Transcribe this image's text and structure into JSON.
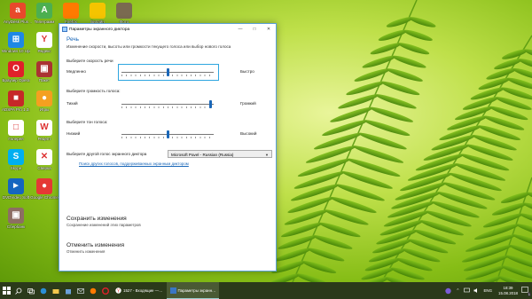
{
  "desktop_icons": [
    {
      "label": "AnyDesk Plus …",
      "color": "#e8492b",
      "glyph": "a"
    },
    {
      "label": "Телеграмм",
      "color": "#4caf50",
      "glyph": "A"
    },
    {
      "label": "Firefox",
      "color": "#ff7a00",
      "glyph": ""
    },
    {
      "label": "Билайн",
      "color": "#f5c400",
      "glyph": ""
    },
    {
      "label": "Фото",
      "color": "#7a6a50",
      "glyph": ""
    },
    {
      "label": "Windows 10 Update As…",
      "color": "#1e88e5",
      "glyph": "⊞"
    },
    {
      "label": "Яндекс",
      "color": "#ffffff",
      "glyph": "Y"
    },
    {
      "label": "Браузер Opera",
      "color": "#e0202a",
      "glyph": "O"
    },
    {
      "label": "Пакет",
      "color": "#a33",
      "glyph": "▣"
    },
    {
      "label": "ADSPA Pro 1.3.1.8",
      "color": "#c62828",
      "glyph": "■"
    },
    {
      "label": "Игры",
      "color": "#f4a020",
      "glyph": "●"
    },
    {
      "label": "Галерея",
      "color": "#ffffff",
      "glyph": "□"
    },
    {
      "label": "Рецепт",
      "color": "#ffffff",
      "glyph": "W"
    },
    {
      "label": "Skype",
      "color": "#00aff0",
      "glyph": "S"
    },
    {
      "label": "Сверка",
      "color": "#ffffff",
      "glyph": "✕"
    },
    {
      "label": "DVDVideo Soft",
      "color": "#1565c0",
      "glyph": "►"
    },
    {
      "label": "Google Chrome",
      "color": "#e53935",
      "glyph": "●"
    },
    {
      "label": "Сбербанк",
      "color": "#8d6e63",
      "glyph": "▣"
    }
  ],
  "window": {
    "title": "Параметры экранного диктора",
    "minimize": "—",
    "maximize": "□",
    "close": "✕",
    "header": "Речь",
    "subheader": "Изменение скорости, высоты или громкости текущего голоса или выбор нового голоса",
    "speed": {
      "label": "Выберите скорость речи",
      "low": "Медленно",
      "high": "Быстро",
      "value": 0.5
    },
    "volume": {
      "label": "Выберите громкость голоса:",
      "low": "Тихий",
      "high": "Громкий",
      "value": 0.97
    },
    "pitch": {
      "label": "Выберите тон голоса:",
      "low": "Низкий",
      "high": "Высокий",
      "value": 0.5
    },
    "voice": {
      "label": "Выберите другой голос экранного диктора",
      "selected": "Microsoft Pavel - Russian (Russia)"
    },
    "link": "Поиск других голосов, поддерживаемых экранным диктором",
    "save": {
      "title": "Сохранить изменения",
      "desc": "Сохранение изменений этих параметров"
    },
    "cancel": {
      "title": "Отменить изменения",
      "desc": "Отменить изменения"
    }
  },
  "taskbar": {
    "apps": [
      {
        "label": "1527 - Входящие —…",
        "active": false
      },
      {
        "label": "Параметры экранн…",
        "active": true
      }
    ],
    "lang": "ENG",
    "time": "18:39",
    "date": "15.08.2018",
    "notif_count": "1"
  }
}
